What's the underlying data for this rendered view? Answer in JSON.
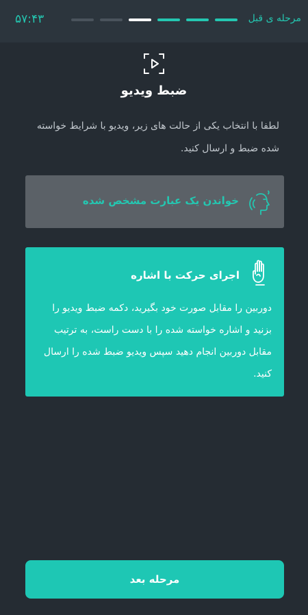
{
  "header": {
    "back_label": "مرحله ی قبل",
    "timer": "۵۷:۴۳",
    "steps": [
      "inactive",
      "inactive",
      "current",
      "done",
      "done",
      "done"
    ]
  },
  "page": {
    "icon": "video-frame-play-icon",
    "title": "ضبط ویدیو",
    "description": "لطفا با انتخاب یکی از حالت های زیر، ویدیو با شرایط خواسته شده ضبط و ارسال کنید."
  },
  "options": [
    {
      "icon": "speaking-face-icon",
      "label": "خواندن یک عبارت مشخص شده",
      "selected": false
    },
    {
      "icon": "hand-gesture-icon",
      "label": "اجرای حرکت با اشاره",
      "description": "دوربین را مقابل صورت خود بگیرید، دکمه ضبط ویدیو را بزنید و اشاره خواسته شده را با دست راست، به ترتیب مقابل دوربین انجام دهید سپس ویدیو ضبط شده را ارسال کنید.",
      "selected": true
    }
  ],
  "footer": {
    "next_label": "مرحله بعد"
  },
  "colors": {
    "background": "#252c33",
    "accent": "#1ec7b4",
    "inactive_card": "#5b6167"
  }
}
